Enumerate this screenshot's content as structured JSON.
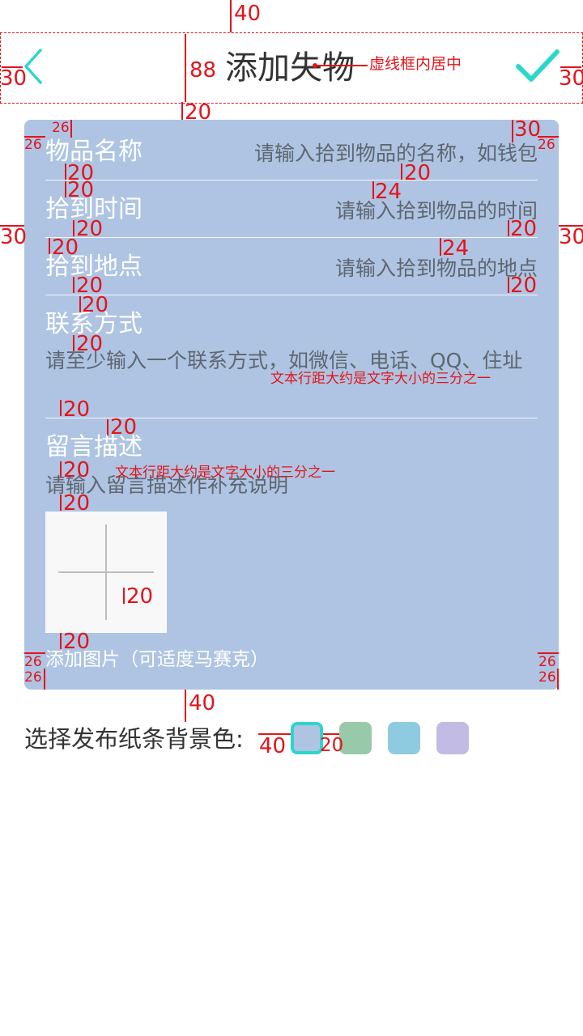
{
  "header": {
    "title": "添加失物"
  },
  "form": {
    "rows": [
      {
        "label": "物品名称",
        "placeholder": "请输入拾到物品的名称，如钱包"
      },
      {
        "label": "拾到时间",
        "placeholder": "请输入拾到物品的时间"
      },
      {
        "label": "拾到地点",
        "placeholder": "请输入拾到物品的地点"
      }
    ],
    "contact": {
      "label": "联系方式",
      "placeholder": "请至少输入一个联系方式，如微信、电话、QQ、住址"
    },
    "note": {
      "label": "留言描述",
      "placeholder": "请输入留言描述作补充说明"
    },
    "add_image_label": "添加图片（可适度马赛克）"
  },
  "color_select": {
    "label": "选择发布纸条背景色:",
    "options": [
      "#aec4e2",
      "#98c9a9",
      "#8ecbe0",
      "#c2bbe3"
    ],
    "selected_index": 0
  },
  "annotations": {
    "top_40": "40",
    "header_88": "88",
    "header_left_30": "30",
    "header_right_30": "30",
    "header_center_note": "虚线框内居中",
    "gap_20_below_header": "20",
    "card_26_top": "26",
    "card_26_left": "26",
    "card_30_right": "30",
    "card_26_right": "26",
    "r1_20a": "20",
    "r1_20b": "20",
    "r1_20c": "20",
    "r2_24": "24",
    "r2_20a": "20",
    "r2_20b": "20",
    "side_30_left": "30",
    "side_30_right": "30",
    "r3_20a": "20",
    "r3_24": "24",
    "r3_20b": "20",
    "r3_20c": "20",
    "r4_20a": "20",
    "r4_20b": "20",
    "line_spacing_note_1": "文本行距大约是文字大小的三分之一",
    "r4_20c": "20",
    "r5_20a": "20",
    "r5_20b": "20",
    "line_spacing_note_2": "文本行距大约是文字大小的三分之一",
    "r5_20c": "20",
    "img_20": "20",
    "img_20_below": "20",
    "bottom_26a": "26",
    "bottom_26b": "26",
    "bottom_26c": "26",
    "bottom_26d": "26",
    "below_card_40": "40",
    "swatch_gap_40": "40",
    "swatch_gap_20": "20"
  }
}
